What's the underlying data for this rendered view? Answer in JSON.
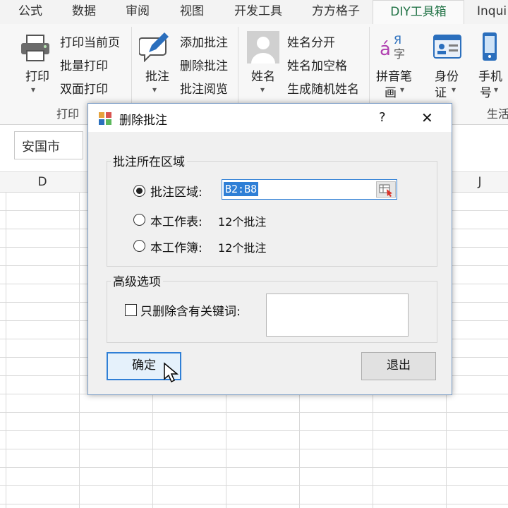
{
  "tabs": [
    "公式",
    "数据",
    "审阅",
    "视图",
    "开发工具",
    "方方格子",
    "DIY工具箱",
    "Inqui"
  ],
  "active_tab": "DIY工具箱",
  "ribbon": {
    "print_button": "打印",
    "print_items": [
      "打印当前页",
      "批量打印",
      "双面打印"
    ],
    "print_group": "打印",
    "comment_button": "批注",
    "comment_items": [
      "添加批注",
      "删除批注",
      "批注阅览"
    ],
    "name_button": "姓名",
    "name_items": [
      "姓名分开",
      "姓名加空格",
      "生成随机姓名"
    ],
    "pinyin_button": [
      "拼音笔",
      "画"
    ],
    "idcard_button": [
      "身份",
      "证"
    ],
    "phone_button": [
      "手机",
      "号"
    ],
    "life_group": "生活"
  },
  "formula_bar": {
    "cell_text": "安国市"
  },
  "columns": [
    "D",
    "J"
  ],
  "dialog": {
    "title": "删除批注",
    "help": "?",
    "close": "✕",
    "region_group": "批注所在区域",
    "option_range": "批注区域:",
    "range_value": "B2:B8",
    "option_sheet": "本工作表:",
    "sheet_count": "12个批注",
    "option_workbook": "本工作簿:",
    "workbook_count": "12个批注",
    "advanced_group": "高级选项",
    "keyword_label": "只删除含有关键词:",
    "keyword_value": "",
    "ok_button": "确定",
    "exit_button": "退出"
  },
  "colors": {
    "accent": "#217346",
    "focus": "#2f7fd6",
    "dialog_bg": "#f0f0f0"
  },
  "state": {
    "selected_option": "range",
    "keyword_checked": false
  }
}
